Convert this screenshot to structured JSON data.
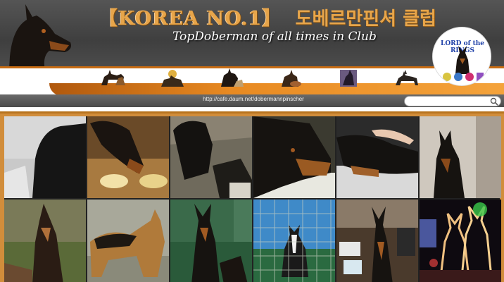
{
  "header": {
    "title_en": "【KOREA NO.1】",
    "title_ko": "도베르만핀셔 클럽",
    "subtitle": "TopDoberman of all times in Club",
    "cafe_url": "http://cafe.daum.net/dobermannpinscher",
    "logo_text": "LORD of the RINGS"
  },
  "search": {
    "placeholder": "",
    "value": ""
  },
  "colors": {
    "accent": "#e88a22",
    "title": "#e7a54a",
    "frame": "#d18d3b",
    "banner": "#4a4a4a"
  },
  "icons": [
    "doberman-silhouette-icon",
    "search-icon",
    "dog-thumbnail-icon",
    "ribbon-icon"
  ],
  "gallery": {
    "photos": [
      {
        "name": "photo-black-dog-couch"
      },
      {
        "name": "photo-doberman-food-bowl"
      },
      {
        "name": "photo-dog-in-dirt"
      },
      {
        "name": "photo-doberman-closeup"
      },
      {
        "name": "photo-doberman-sleeping"
      },
      {
        "name": "photo-doberman-sitting"
      },
      {
        "name": "photo-doberman-lying-grass"
      },
      {
        "name": "photo-german-shepherd"
      },
      {
        "name": "photo-doberman-standing-green"
      },
      {
        "name": "photo-dog-in-cage"
      },
      {
        "name": "photo-doberman-with-items"
      },
      {
        "name": "photo-christmas-lights-deer"
      }
    ]
  }
}
